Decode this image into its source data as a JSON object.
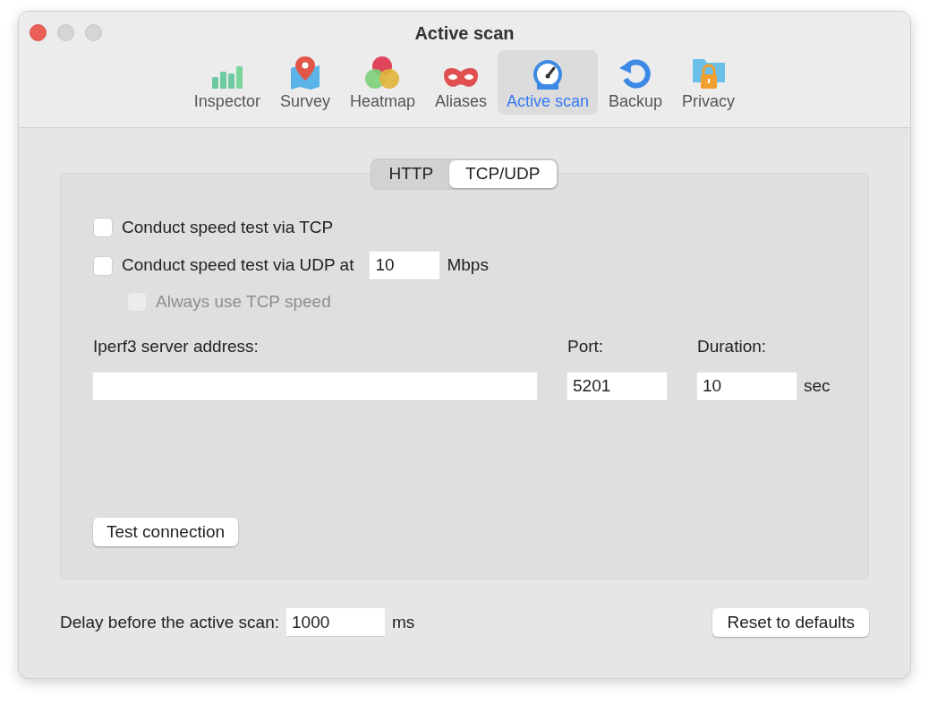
{
  "window": {
    "title": "Active scan"
  },
  "toolbar": [
    {
      "label": "Inspector",
      "kind": "bars",
      "selected": false
    },
    {
      "label": "Survey",
      "kind": "map",
      "selected": false
    },
    {
      "label": "Heatmap",
      "kind": "blobs",
      "selected": false
    },
    {
      "label": "Aliases",
      "kind": "mask",
      "selected": false
    },
    {
      "label": "Active scan",
      "kind": "gauge",
      "selected": true
    },
    {
      "label": "Backup",
      "kind": "restore",
      "selected": false
    },
    {
      "label": "Privacy",
      "kind": "lock",
      "selected": false
    }
  ],
  "segments": [
    {
      "label": "HTTP",
      "selected": false
    },
    {
      "label": "TCP/UDP",
      "selected": true
    }
  ],
  "tcp_checkbox": {
    "label": "Conduct speed test via TCP",
    "checked": false,
    "disabled": false
  },
  "udp_checkbox": {
    "label": "Conduct speed test via UDP at",
    "checked": false,
    "disabled": false,
    "value": "10",
    "unit": "Mbps"
  },
  "always_tcp_checkbox": {
    "label": "Always use TCP speed",
    "checked": false,
    "disabled": true
  },
  "server": {
    "label": "Iperf3 server address:"
  },
  "port": {
    "label": "Port:",
    "value": "5201"
  },
  "duration": {
    "label": "Duration:",
    "value": "10",
    "unit": "sec"
  },
  "test_button": "Test connection",
  "delay": {
    "label": "Delay before the active scan:",
    "value": "1000",
    "unit": "ms"
  },
  "reset_button": "Reset to defaults"
}
